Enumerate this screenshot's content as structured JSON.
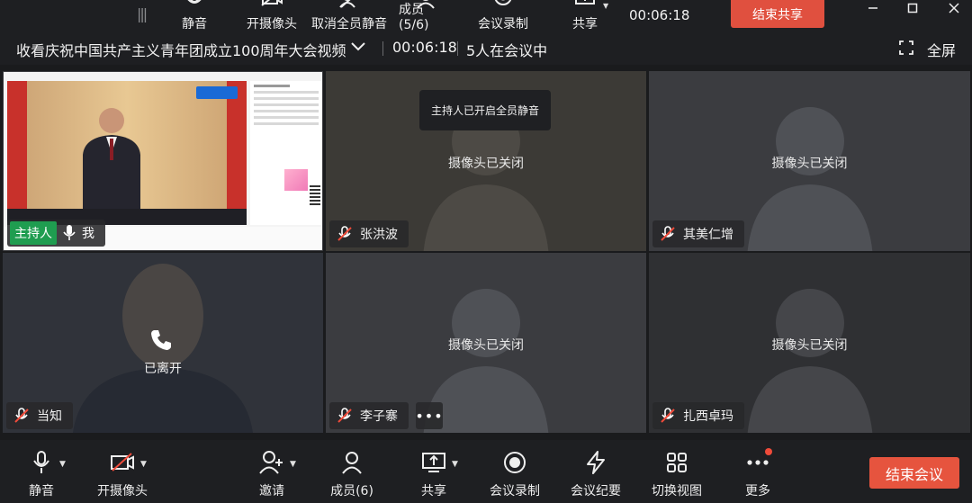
{
  "top_toolbar": {
    "mute_label": "静音",
    "camera_label": "开摄像头",
    "mute_all_label": "取消全员静音",
    "members_label": "成员(5/6)",
    "record_label": "会议录制",
    "share_label": "共享",
    "timer": "00:06:18",
    "end_share_label": "结束共享"
  },
  "title_bar": {
    "meeting_title": "收看庆祝中国共产主义青年团成立100周年大会视频",
    "duration": "00:06:18",
    "participants_text": "5人在会议中",
    "fullscreen_label": "全屏"
  },
  "tiles": {
    "host": {
      "role_badge": "主持人",
      "name": "我"
    },
    "zhang": {
      "name": "张洪波",
      "status": "摄像头已关闭",
      "toast": "主持人已开启全员静音"
    },
    "qimei": {
      "name": "其美仁增",
      "status": "摄像头已关闭"
    },
    "dangzhi": {
      "name": "当知",
      "status": "已离开"
    },
    "lizi": {
      "name": "李子寨",
      "status": "摄像头已关闭",
      "more": "•••"
    },
    "zhaxi": {
      "name": "扎西卓玛",
      "status": "摄像头已关闭"
    }
  },
  "bottom_toolbar": {
    "mute_label": "静音",
    "camera_label": "开摄像头",
    "invite_label": "邀请",
    "members_label": "成员(6)",
    "share_label": "共享",
    "record_label": "会议录制",
    "minutes_label": "会议纪要",
    "switch_view_label": "切换视图",
    "more_label": "更多",
    "end_meeting_label": "结束会议"
  },
  "colors": {
    "end_button": "#e6543e",
    "host_badge": "#1f9d50",
    "toolbar_bg": "#1e1f22"
  }
}
